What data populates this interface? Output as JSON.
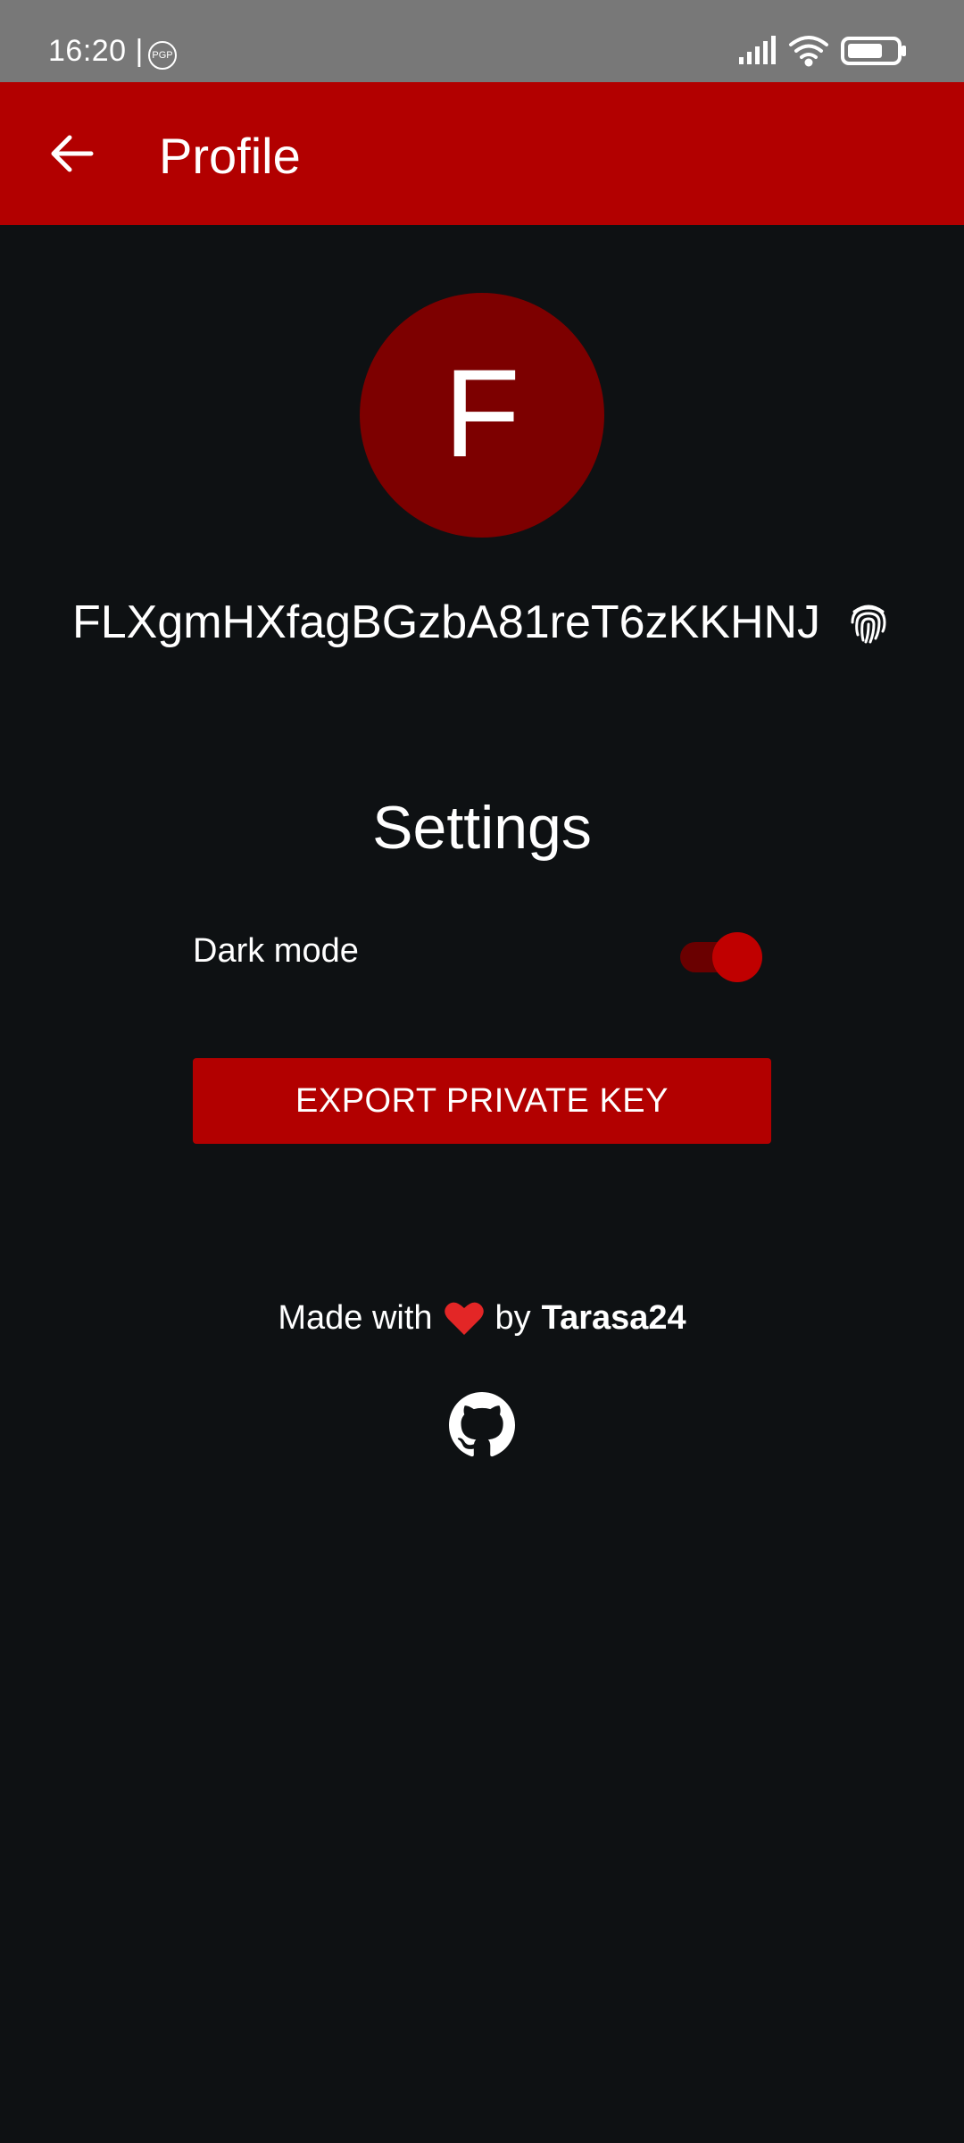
{
  "status_bar": {
    "time": "16:20 |",
    "pgp_badge": "PGP",
    "icons": [
      "signal-icon",
      "wifi-icon",
      "battery-icon"
    ]
  },
  "app_bar": {
    "title": "Profile",
    "back_icon": "arrow-back-icon"
  },
  "profile": {
    "avatar_letter": "F",
    "public_key": "FLXgmHXfagBGzbA81reT6zKKHNJ",
    "key_icon": "fingerprint-icon"
  },
  "settings": {
    "title": "Settings",
    "dark_mode_label": "Dark mode",
    "dark_mode_enabled": true,
    "export_button_label": "EXPORT PRIVATE KEY"
  },
  "footer": {
    "made_with": "Made with",
    "by": "by",
    "author": "Tarasa24",
    "heart_icon": "heart-icon",
    "github_icon": "github-icon"
  },
  "colors": {
    "accent": "#b20000",
    "avatar": "#7d0000",
    "background": "#0e1113",
    "status_bar": "#787878"
  }
}
